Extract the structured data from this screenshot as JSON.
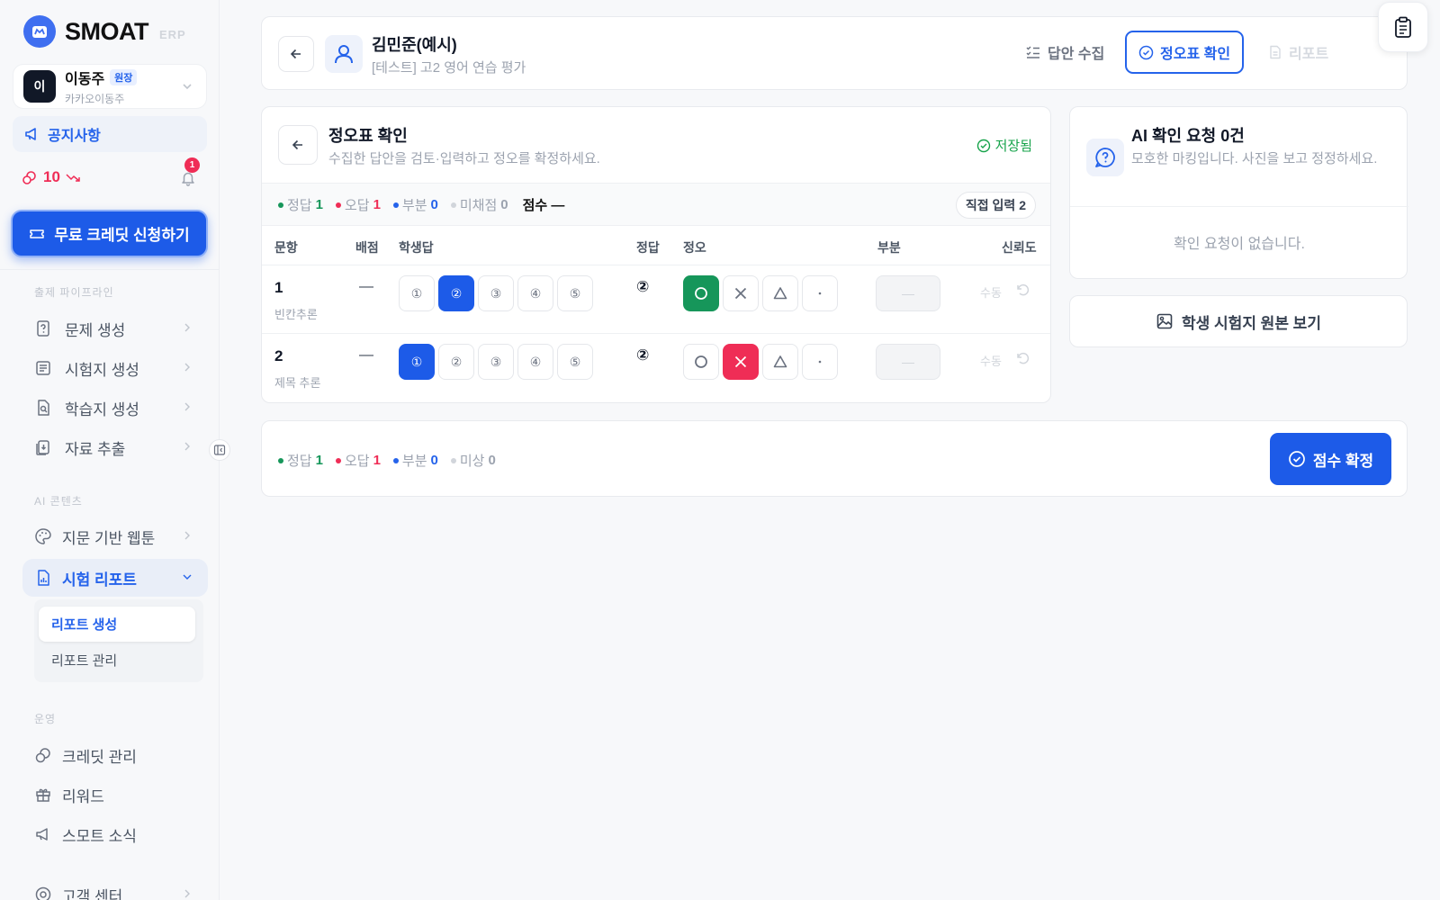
{
  "sidebar": {
    "brand": "SMOAT",
    "brand_suffix": "ERP",
    "user": {
      "initial": "이",
      "name": "이동주",
      "role": "원장",
      "org": "카카오이동주"
    },
    "notice_label": "공지사항",
    "credits": "10",
    "bell_badge": "1",
    "free_credit_button": "무료 크레딧 신청하기",
    "sections": {
      "pipeline": "출제 파이프라인",
      "ai": "AI 콘텐츠",
      "ops": "운영"
    },
    "pipeline_items": [
      "문제 생성",
      "시험지 생성",
      "학습지 생성",
      "자료 추출"
    ],
    "ai_items": [
      "지문 기반 웹툰",
      "시험 리포트"
    ],
    "report_sub": [
      "리포트 생성",
      "리포트 관리"
    ],
    "ops_items": [
      "크레딧 관리",
      "리워드",
      "스모트 소식",
      "고객 센터"
    ]
  },
  "topbar": {
    "student_name": "김민준(예시)",
    "exam_title": "[테스트] 고2 영어 연습 평가",
    "tabs": [
      "답안 수집",
      "정오표 확인",
      "리포트"
    ],
    "active_tab": "정오표 확인"
  },
  "grading": {
    "title": "정오표 확인",
    "subtitle": "수집한 답안을 검토·입력하고 정오를 확정하세요.",
    "saved": "저장됨",
    "summary": {
      "correct_label": "정답",
      "correct": "1",
      "wrong_label": "오답",
      "wrong": "1",
      "partial_label": "부분",
      "partial": "0",
      "ungraded_label": "미채점",
      "ungraded": "0",
      "score_label": "점수",
      "score": "—"
    },
    "direct_input": "직접 입력 2",
    "columns": [
      "문항",
      "배점",
      "학생답",
      "정답",
      "정오",
      "부분",
      "신뢰도"
    ],
    "choices": [
      "①",
      "②",
      "③",
      "④",
      "⑤"
    ],
    "marks": [
      "O",
      "X",
      "△",
      "·"
    ],
    "rows": [
      {
        "num": "1",
        "type": "빈칸추론",
        "points": "—",
        "student_answer": 2,
        "correct": "②",
        "mark": "O",
        "partial": "—",
        "confidence": "수동"
      },
      {
        "num": "2",
        "type": "제목 추론",
        "points": "—",
        "student_answer": 1,
        "correct": "②",
        "mark": "X",
        "partial": "—",
        "confidence": "수동"
      }
    ]
  },
  "ai_panel": {
    "title": "AI 확인 요청 0건",
    "subtitle": "모호한 마킹입니다. 사진을 보고 정정하세요.",
    "empty": "확인 요청이 없습니다.",
    "original_button": "학생 시험지 원본 보기"
  },
  "footer": {
    "correct_label": "정답",
    "correct": "1",
    "wrong_label": "오답",
    "wrong": "1",
    "partial_label": "부분",
    "partial": "0",
    "unset_label": "미상",
    "unset": "0",
    "confirm_button": "점수 확정"
  },
  "colors": {
    "primary": "#1d5be8",
    "correct": "#16965a",
    "wrong": "#ef2d56",
    "partial": "#2563eb",
    "muted": "#c0c5cd"
  }
}
